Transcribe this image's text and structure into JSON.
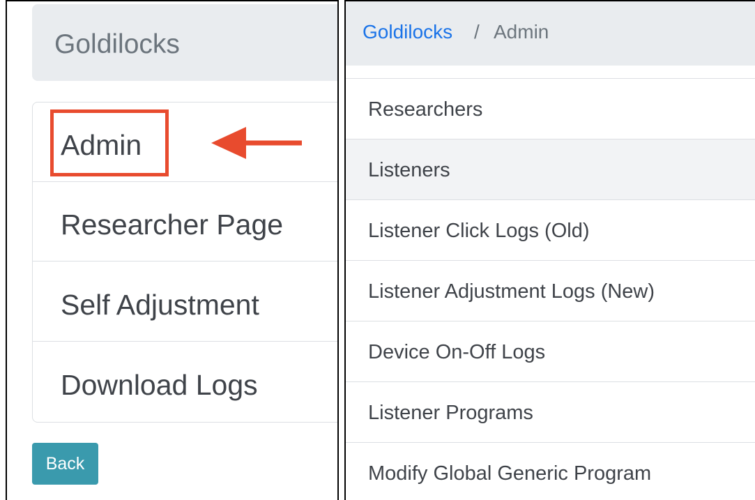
{
  "left": {
    "header_title": "Goldilocks",
    "menu": [
      {
        "label": "Admin",
        "highlighted": true
      },
      {
        "label": "Researcher Page"
      },
      {
        "label": "Self Adjustment"
      },
      {
        "label": "Download Logs"
      }
    ],
    "back_label": "Back",
    "annotation": {
      "highlight_color": "#e84b2e",
      "arrow_color": "#e84b2e",
      "arrow_icon": "left-arrow-icon"
    }
  },
  "right": {
    "breadcrumb": {
      "root": "Goldilocks",
      "separator": "/",
      "current": "Admin"
    },
    "items": [
      {
        "label": "Researchers"
      },
      {
        "label": "Listeners",
        "active": true
      },
      {
        "label": "Listener Click Logs (Old)"
      },
      {
        "label": "Listener Adjustment Logs (New)"
      },
      {
        "label": "Device On-Off Logs"
      },
      {
        "label": "Listener Programs"
      },
      {
        "label": "Modify Global Generic Program"
      }
    ]
  },
  "colors": {
    "link": "#1a73e8",
    "button": "#3a9aad",
    "header_bg": "#e9ecef",
    "annotation": "#e84b2e"
  }
}
